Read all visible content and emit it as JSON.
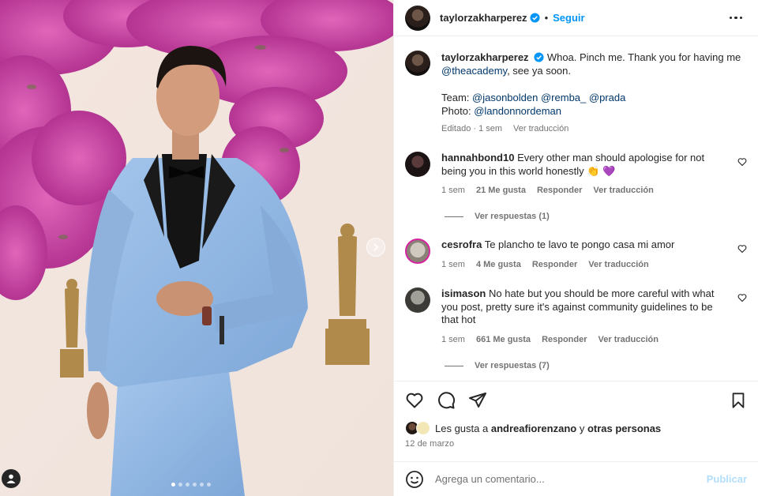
{
  "header": {
    "username": "taylorzakharperez",
    "separator": "•",
    "follow_label": "Seguir"
  },
  "caption": {
    "username": "taylorzakharperez",
    "text_1": "Whoa. Pinch me. Thank you for having me",
    "mention_1": "@theacademy",
    "text_2": ", see ya soon.",
    "team_label": "Team:",
    "team_mentions": [
      "@jasonbolden",
      "@remba_",
      "@prada"
    ],
    "photo_label": "Photo:",
    "photo_mention": "@landonnordeman",
    "edited": "Editado · 1 sem",
    "translate": "Ver traducción"
  },
  "comments": [
    {
      "username": "hannahbond10",
      "text": "Every other man should apologise for not being you in this world honestly 👏 💜",
      "time": "1 sem",
      "likes": "21 Me gusta",
      "reply": "Responder",
      "translate": "Ver traducción",
      "replies": "Ver respuestas (1)"
    },
    {
      "username": "cesrofra",
      "text": "Te plancho te lavo te pongo casa mi amor",
      "time": "1 sem",
      "likes": "4 Me gusta",
      "reply": "Responder",
      "translate": "Ver traducción"
    },
    {
      "username": "isimason",
      "text": "No hate but you should be more careful with what you post, pretty sure it's against community guidelines to be that hot",
      "time": "1 sem",
      "likes": "661 Me gusta",
      "reply": "Responder",
      "translate": "Ver traducción",
      "replies": "Ver respuestas (7)"
    }
  ],
  "likes_line": {
    "prefix": "Les gusta a",
    "user": "andreafiorenzano",
    "middle": "y",
    "others": "otras personas"
  },
  "post_date": "12 de marzo",
  "composer": {
    "placeholder": "Agrega un comentario...",
    "publish_label": "Publicar"
  },
  "carousel": {
    "total": 6,
    "active": 1
  },
  "colors": {
    "accent": "#0095f6",
    "suit": "#8fb6e3",
    "flowers": "#c0329a"
  },
  "icons": [
    "heart-icon",
    "comment-icon",
    "share-icon",
    "bookmark-icon",
    "emoji-icon",
    "verified-icon",
    "more-icon",
    "chevron-right-icon",
    "person-tag-icon"
  ]
}
